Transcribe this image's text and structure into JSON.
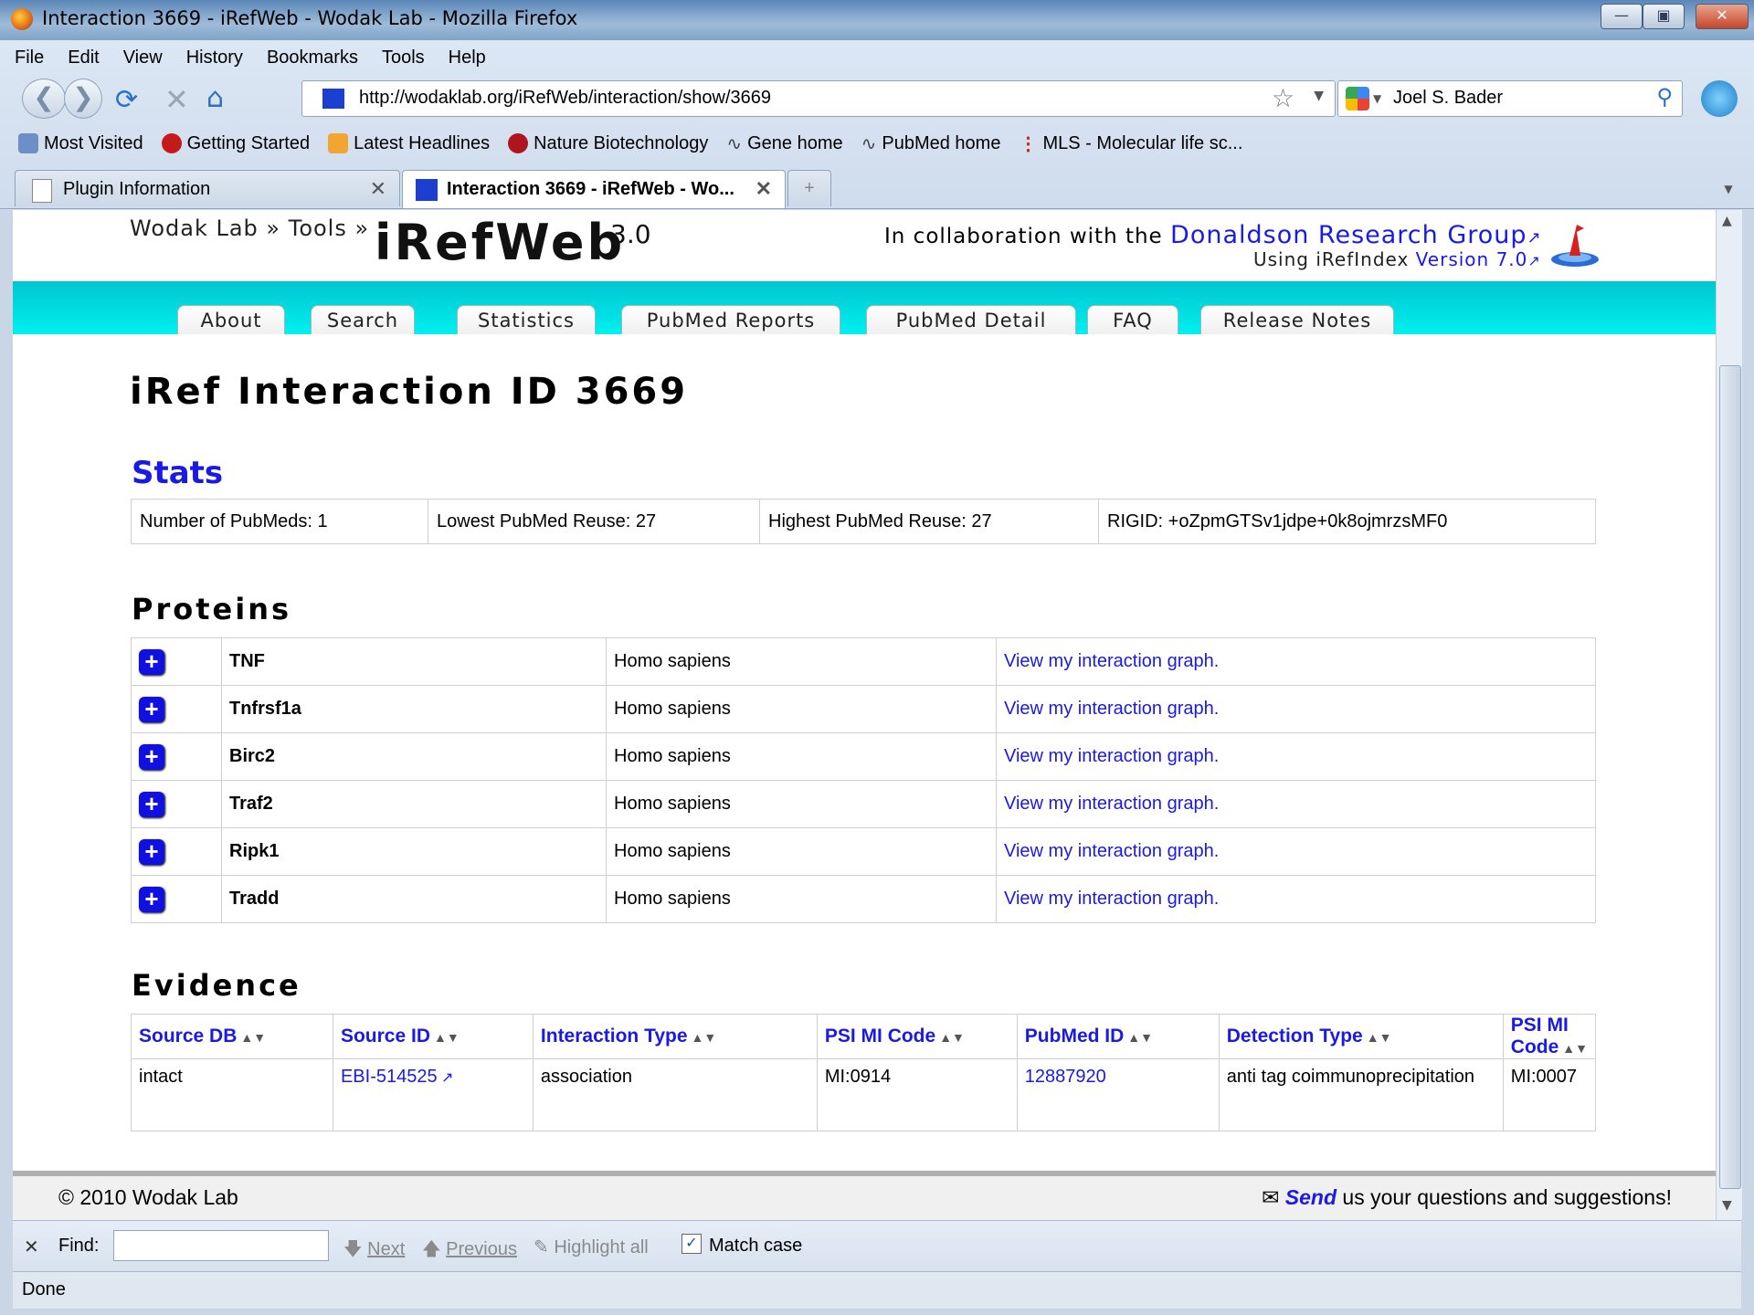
{
  "window": {
    "title": "Interaction 3669 - iRefWeb - Wodak Lab - Mozilla Firefox"
  },
  "menu": [
    "File",
    "Edit",
    "View",
    "History",
    "Bookmarks",
    "Tools",
    "Help"
  ],
  "url": "http://wodaklab.org/iRefWeb/interaction/show/3669",
  "search_value": "Joel S. Bader",
  "bookmarks": [
    "Most Visited",
    "Getting Started",
    "Latest Headlines",
    "Nature Biotechnology",
    "Gene home",
    "PubMed home",
    "MLS - Molecular life sc..."
  ],
  "tabs": [
    {
      "label": "Plugin Information",
      "active": false
    },
    {
      "label": "Interaction 3669 - iRefWeb - Wo...",
      "active": true
    }
  ],
  "site": {
    "crumb": "Wodak Lab » Tools »",
    "logo": "iRefWeb",
    "version": "3.0",
    "collab_prefix": "In collaboration with the",
    "collab_link": "Donaldson Research Group",
    "using_prefix": "Using iRefIndex",
    "using_link": "Version 7.0",
    "nav": [
      "About",
      "Search",
      "Statistics",
      "PubMed Reports",
      "PubMed Detail",
      "FAQ",
      "Release Notes"
    ]
  },
  "page_title": "iRef Interaction ID 3669",
  "stats": {
    "heading": "Stats",
    "cells": [
      "Number of PubMeds: 1",
      "Lowest PubMed Reuse: 27",
      "Highest PubMed Reuse: 27",
      "RIGID: +oZpmGTSv1jdpe+0k8ojmrzsMF0"
    ]
  },
  "proteins": {
    "heading": "Proteins",
    "link_text": "View my interaction graph.",
    "rows": [
      {
        "name": "TNF",
        "organism": "Homo sapiens"
      },
      {
        "name": "Tnfrsf1a",
        "organism": "Homo sapiens"
      },
      {
        "name": "Birc2",
        "organism": "Homo sapiens"
      },
      {
        "name": "Traf2",
        "organism": "Homo sapiens"
      },
      {
        "name": "Ripk1",
        "organism": "Homo sapiens"
      },
      {
        "name": "Tradd",
        "organism": "Homo sapiens"
      }
    ]
  },
  "evidence": {
    "heading": "Evidence",
    "columns": [
      "Source DB",
      "Source ID",
      "Interaction Type",
      "PSI MI Code",
      "PubMed ID",
      "Detection Type",
      "PSI MI Code"
    ],
    "rows": [
      [
        "intact",
        "EBI-514525",
        "association",
        "MI:0914",
        "12887920",
        "anti tag coimmunoprecipitation",
        "MI:0007"
      ]
    ]
  },
  "footer": {
    "copyright": "© 2010 Wodak Lab",
    "send": "Send",
    "send_rest": "us your questions and suggestions!"
  },
  "findbar": {
    "label": "Find:",
    "value": "",
    "next": "Next",
    "previous": "Previous",
    "highlight": "Highlight all",
    "match_case": "Match case"
  },
  "status": "Done"
}
